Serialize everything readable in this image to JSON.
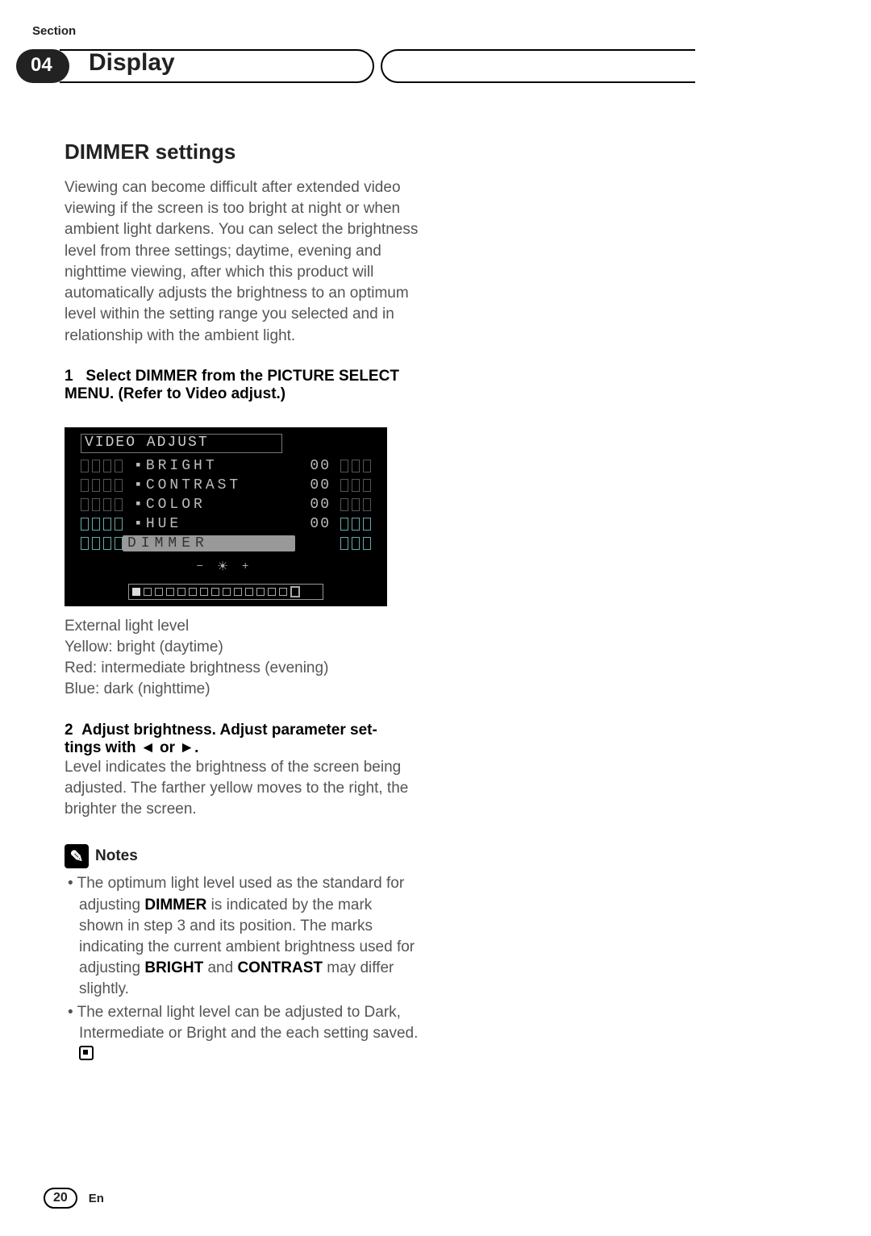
{
  "header": {
    "section_label": "Section",
    "chapter_number": "04",
    "chapter_title": "Display"
  },
  "heading": "DIMMER settings",
  "intro": "Viewing can become difficult after extended video viewing if the screen is too bright at night or when ambient light darkens. You can select the brightness level from three settings; daytime, evening and nighttime viewing, after which this product will automatically adjusts the brightness to an optimum level within the setting range you selected and in relationship with the ambient light.",
  "step1": {
    "num": "1",
    "lead": "Select",
    "kw1": "DIMMER",
    "mid": "from the",
    "kw2": "PICTURE SELECT MENU.",
    "tail": "(Refer to Video adjust.)"
  },
  "menu": {
    "title": "VIDEO ADJUST",
    "rows": [
      {
        "label": "BRIGHT",
        "value": "00"
      },
      {
        "label": "CONTRAST",
        "value": "00"
      },
      {
        "label": "COLOR",
        "value": "00"
      },
      {
        "label": "HUE",
        "value": "00"
      },
      {
        "label": "DIMMER",
        "value": ""
      }
    ],
    "slider_minus": "−",
    "slider_sun": "☀",
    "slider_plus": "+"
  },
  "legend": {
    "l1": "External light level",
    "l2": "Yellow: bright (daytime)",
    "l3": "Red: intermediate brightness (evening)",
    "l4": "Blue: dark (nighttime)"
  },
  "step2": {
    "num": "2",
    "text_a": "Adjust brightness. Adjust parameter set-",
    "text_b": "tings with ◄ or ►."
  },
  "step2_body": "Level indicates the brightness of the screen being adjusted. The farther yellow moves to the right, the brighter the screen.",
  "notes_label": "Notes",
  "notes": [
    {
      "pre": "The optimum light level used as the standard for adjusting ",
      "kw1": "DIMMER",
      "mid1": " is indicated by the mark shown in step 3 and its position. The marks indicating the current ambient brightness used for adjusting ",
      "kw2": "BRIGHT",
      "mid2": " and ",
      "kw3": "CONTRAST",
      "post": " may differ slightly."
    },
    {
      "pre": "The external light level can be adjusted to Dark, Intermediate or Bright and the each setting saved.",
      "kw1": "",
      "mid1": "",
      "kw2": "",
      "mid2": "",
      "kw3": "",
      "post": ""
    }
  ],
  "footer": {
    "page": "20",
    "lang": "En"
  }
}
